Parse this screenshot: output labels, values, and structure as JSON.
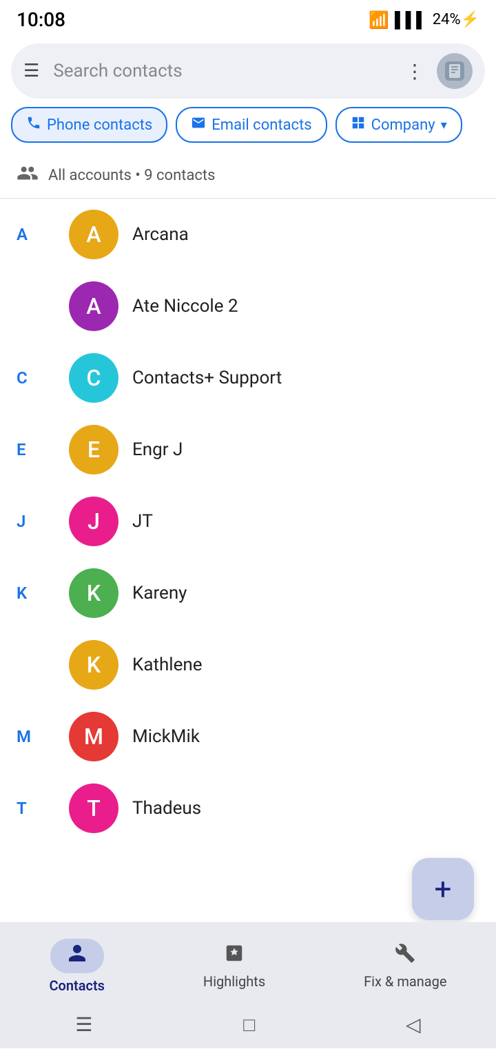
{
  "status": {
    "time": "10:08",
    "battery": "24%",
    "battery_icon": "⚡"
  },
  "search": {
    "placeholder": "Search contacts",
    "hamburger": "☰",
    "more": "⋮"
  },
  "chips": [
    {
      "id": "phone",
      "label": "Phone contacts",
      "icon": "📞",
      "active": true
    },
    {
      "id": "email",
      "label": "Email contacts",
      "icon": "✉",
      "active": false
    },
    {
      "id": "company",
      "label": "Company",
      "icon": "⊞",
      "active": false,
      "dropdown": true
    }
  ],
  "account_row": {
    "icon": "👥",
    "text": "All accounts • 9 contacts"
  },
  "contacts": [
    {
      "letter": "A",
      "name": "Arcana",
      "initial": "A",
      "color": "#E6A817"
    },
    {
      "letter": "",
      "name": "Ate Niccole 2",
      "initial": "A",
      "color": "#9C27B0"
    },
    {
      "letter": "C",
      "name": "Contacts+ Support",
      "initial": "C",
      "color": "#26C6DA"
    },
    {
      "letter": "E",
      "name": "Engr J",
      "initial": "E",
      "color": "#E6A817"
    },
    {
      "letter": "J",
      "name": "JT",
      "initial": "J",
      "color": "#E91E8C"
    },
    {
      "letter": "K",
      "name": "Kareny",
      "initial": "K",
      "color": "#4CAF50"
    },
    {
      "letter": "",
      "name": "Kathlene",
      "initial": "K",
      "color": "#E6A817"
    },
    {
      "letter": "M",
      "name": "MickMik",
      "initial": "M",
      "color": "#E53935"
    },
    {
      "letter": "T",
      "name": "Thadeus",
      "initial": "T",
      "color": "#E91E8C"
    }
  ],
  "fab": {
    "icon": "+"
  },
  "bottom_nav": {
    "tabs": [
      {
        "id": "contacts",
        "label": "Contacts",
        "icon": "👤",
        "active": true
      },
      {
        "id": "highlights",
        "label": "Highlights",
        "icon": "✨",
        "active": false
      },
      {
        "id": "fix",
        "label": "Fix & manage",
        "icon": "🔧",
        "active": false
      }
    ]
  }
}
